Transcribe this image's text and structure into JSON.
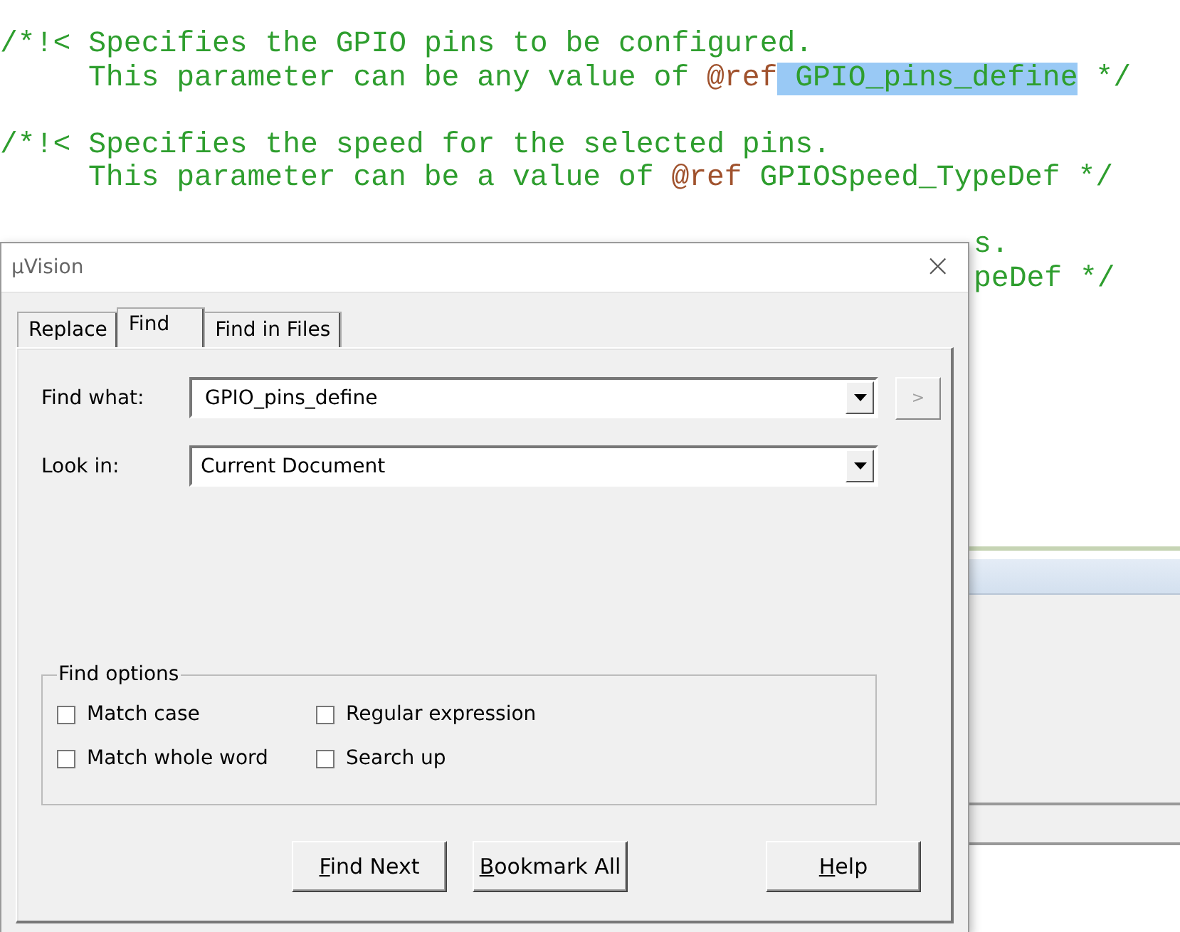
{
  "editor": {
    "lines": [
      {
        "kind": "code",
        "segments": [
          {
            "kind": "comment",
            "text": "/*!< Specifies the GPIO pins to be configured."
          }
        ]
      },
      {
        "kind": "continuation",
        "segments": [
          {
            "kind": "comment",
            "text": "This parameter can be any value of "
          },
          {
            "kind": "tag",
            "text": "@ref"
          },
          {
            "kind": "selection",
            "text": " GPIO_pins_define"
          },
          {
            "kind": "comment",
            "text": " */"
          }
        ]
      },
      {
        "kind": "blank"
      },
      {
        "kind": "code",
        "segments": [
          {
            "kind": "comment",
            "text": "/*!< Specifies the speed for the selected pins."
          }
        ]
      },
      {
        "kind": "continuation",
        "segments": [
          {
            "kind": "comment",
            "text": "This parameter can be a value of "
          },
          {
            "kind": "tag",
            "text": "@ref"
          },
          {
            "kind": "comment",
            "text": " GPIOSpeed_TypeDef */"
          }
        ]
      },
      {
        "kind": "blank"
      },
      {
        "kind": "partial",
        "segments": [
          {
            "kind": "comment",
            "text": "s."
          }
        ]
      },
      {
        "kind": "partial",
        "segments": [
          {
            "kind": "comment",
            "text": "peDef */"
          }
        ]
      }
    ]
  },
  "dialog": {
    "title": "μVision",
    "close": "×",
    "tabs": [
      {
        "label": "Replace",
        "selected": false
      },
      {
        "label": "Find",
        "selected": true
      },
      {
        "label": "Find in Files",
        "selected": false
      }
    ],
    "fields": [
      {
        "label": "Find what:",
        "value": "GPIO_pins_define",
        "extra_button": {
          "label": ">",
          "disabled": true
        }
      },
      {
        "label": "Look in:",
        "value": "Current Document"
      }
    ],
    "options": {
      "title": "Find options",
      "items": [
        {
          "label": "Match case",
          "checked": false
        },
        {
          "label": "Regular expression",
          "checked": false
        },
        {
          "label": "Match whole word",
          "checked": false
        },
        {
          "label": "Search up",
          "checked": false
        }
      ]
    },
    "buttons": [
      "Find Next",
      "Bookmark All",
      "Help"
    ]
  }
}
